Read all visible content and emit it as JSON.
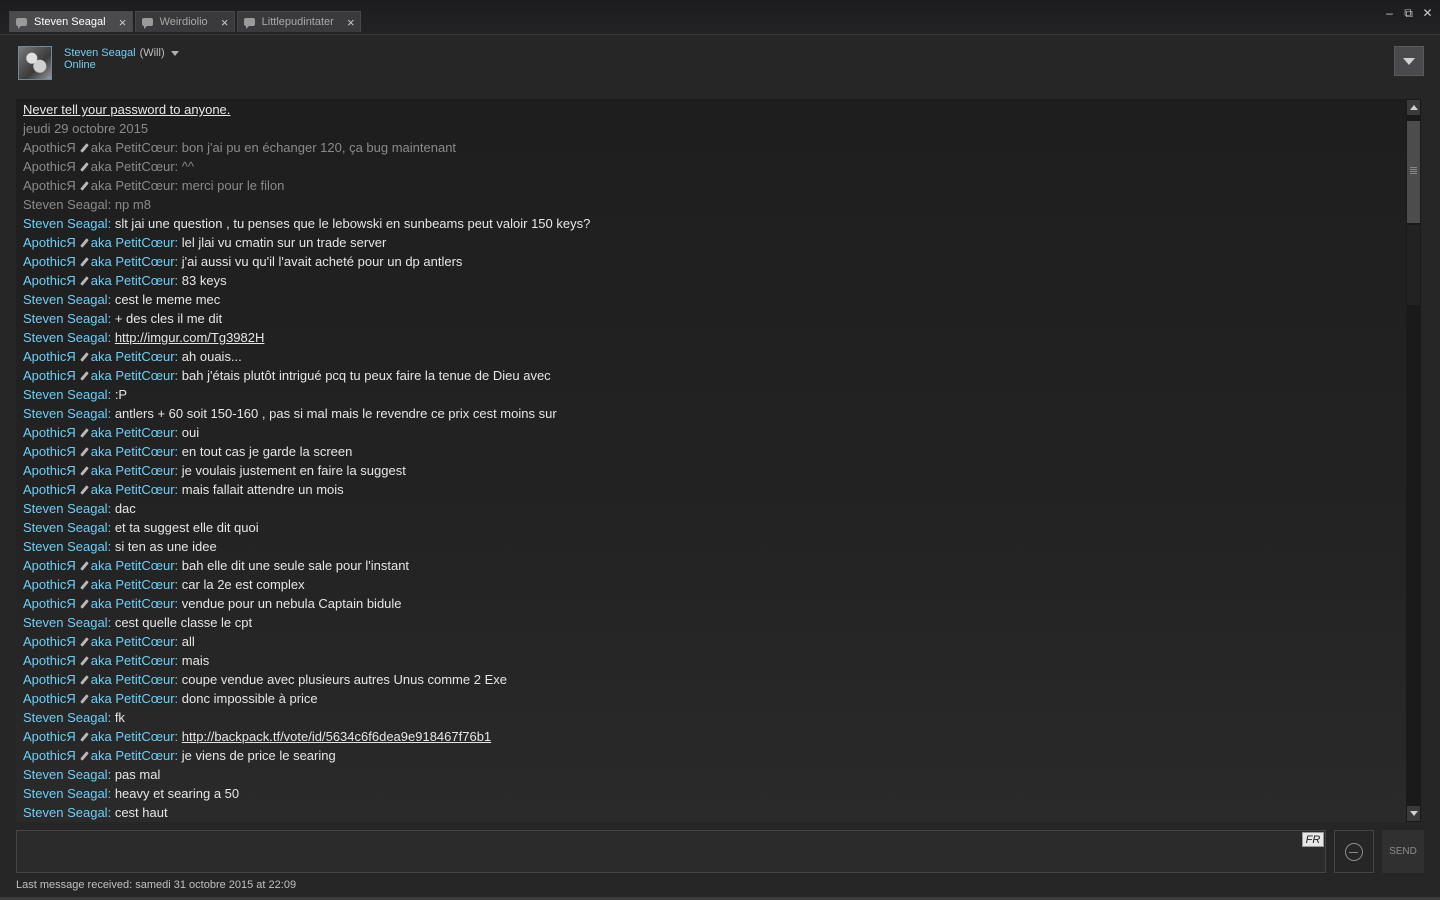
{
  "tabs": [
    {
      "label": "Steven Seagal",
      "active": true
    },
    {
      "label": "Weirdiolio",
      "active": false
    },
    {
      "label": "Littlepudintater",
      "active": false
    }
  ],
  "window": {
    "minimize": "–",
    "maximize": "⧉",
    "close": "✕"
  },
  "header": {
    "name": "Steven Seagal",
    "nickname": "(Will)",
    "status": "Online"
  },
  "chat": {
    "warning": "Never tell your password to anyone.",
    "date": "jeudi 29 octobre 2015",
    "messages": [
      {
        "who": "a",
        "old": true,
        "name": "ApothicЯ",
        "aka": "aka PetitCœur:",
        "text": "bon j'ai pu en échanger 120, ça bug maintenant"
      },
      {
        "who": "a",
        "old": true,
        "name": "ApothicЯ",
        "aka": "aka PetitCœur:",
        "text": "^^"
      },
      {
        "who": "a",
        "old": true,
        "name": "ApothicЯ",
        "aka": "aka PetitCœur:",
        "text": "merci pour le filon"
      },
      {
        "who": "s",
        "old": true,
        "name": "Steven Seagal:",
        "text": "np m8"
      },
      {
        "who": "s",
        "name": "Steven Seagal:",
        "text": "slt jai une question , tu penses que le lebowski en sunbeams peut valoir 150 keys?"
      },
      {
        "who": "a",
        "name": "ApothicЯ",
        "aka": "aka PetitCœur:",
        "text": "lel jlai vu cmatin sur un trade server"
      },
      {
        "who": "a",
        "name": "ApothicЯ",
        "aka": "aka PetitCœur:",
        "text": "j'ai aussi vu qu'il l'avait acheté pour un dp antlers"
      },
      {
        "who": "a",
        "name": "ApothicЯ",
        "aka": "aka PetitCœur:",
        "text": "83 keys"
      },
      {
        "who": "s",
        "name": "Steven Seagal:",
        "text": "cest le meme mec"
      },
      {
        "who": "s",
        "name": "Steven Seagal:",
        "text": "+ des cles il me dit"
      },
      {
        "who": "s",
        "name": "Steven Seagal:",
        "text": "http://imgur.com/Tg3982H",
        "link": true
      },
      {
        "who": "a",
        "name": "ApothicЯ",
        "aka": "aka PetitCœur:",
        "text": "ah ouais..."
      },
      {
        "who": "a",
        "name": "ApothicЯ",
        "aka": "aka PetitCœur:",
        "text": "bah j'étais plutôt intrigué pcq tu peux faire la tenue de Dieu avec"
      },
      {
        "who": "s",
        "name": "Steven Seagal:",
        "text": ":P"
      },
      {
        "who": "s",
        "name": "Steven Seagal:",
        "text": "antlers + 60 soit 150-160 , pas si mal mais le revendre ce prix cest moins sur"
      },
      {
        "who": "a",
        "name": "ApothicЯ",
        "aka": "aka PetitCœur:",
        "text": "oui"
      },
      {
        "who": "a",
        "name": "ApothicЯ",
        "aka": "aka PetitCœur:",
        "text": "en tout cas je garde la screen"
      },
      {
        "who": "a",
        "name": "ApothicЯ",
        "aka": "aka PetitCœur:",
        "text": "je voulais justement en faire la suggest"
      },
      {
        "who": "a",
        "name": "ApothicЯ",
        "aka": "aka PetitCœur:",
        "text": "mais fallait attendre un mois"
      },
      {
        "who": "s",
        "name": "Steven Seagal:",
        "text": "dac"
      },
      {
        "who": "s",
        "name": "Steven Seagal:",
        "text": "et ta suggest elle dit quoi"
      },
      {
        "who": "s",
        "name": "Steven Seagal:",
        "text": "si ten as une idee"
      },
      {
        "who": "a",
        "name": "ApothicЯ",
        "aka": "aka PetitCœur:",
        "text": "bah elle dit une seule sale pour l'instant"
      },
      {
        "who": "a",
        "name": "ApothicЯ",
        "aka": "aka PetitCœur:",
        "text": "car la 2e est complex"
      },
      {
        "who": "a",
        "name": "ApothicЯ",
        "aka": "aka PetitCœur:",
        "text": "vendue pour un nebula Captain bidule"
      },
      {
        "who": "s",
        "name": "Steven Seagal:",
        "text": "cest quelle classe le cpt"
      },
      {
        "who": "a",
        "name": "ApothicЯ",
        "aka": "aka PetitCœur:",
        "text": "all"
      },
      {
        "who": "a",
        "name": "ApothicЯ",
        "aka": "aka PetitCœur:",
        "text": "mais"
      },
      {
        "who": "a",
        "name": "ApothicЯ",
        "aka": "aka PetitCœur:",
        "text": "coupe vendue avec plusieurs autres Unus comme 2 Exe"
      },
      {
        "who": "a",
        "name": "ApothicЯ",
        "aka": "aka PetitCœur:",
        "text": "donc impossible à price"
      },
      {
        "who": "s",
        "name": "Steven Seagal:",
        "text": "fk"
      },
      {
        "who": "a",
        "name": "ApothicЯ",
        "aka": "aka PetitCœur:",
        "text": "http://backpack.tf/vote/id/5634c6f6dea9e918467f76b1",
        "link": true
      },
      {
        "who": "a",
        "name": "ApothicЯ",
        "aka": "aka PetitCœur:",
        "text": "je viens de price le searing"
      },
      {
        "who": "s",
        "name": "Steven Seagal:",
        "text": "pas mal"
      },
      {
        "who": "s",
        "name": "Steven Seagal:",
        "text": "heavy et searing a 50"
      },
      {
        "who": "s",
        "name": "Steven Seagal:",
        "text": "cest haut"
      }
    ]
  },
  "input": {
    "value": "",
    "lang": "FR"
  },
  "send_label": "SEND",
  "footer": "Last message received: samedi 31 octobre 2015 at 22:09"
}
